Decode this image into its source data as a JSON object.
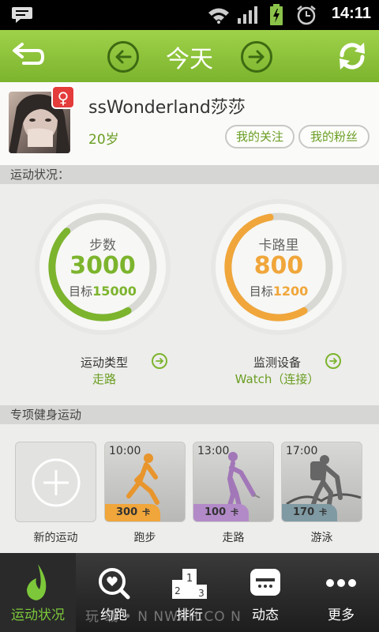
{
  "status_bar": {
    "time": "14:11"
  },
  "title_bar": {
    "title": "今天"
  },
  "profile": {
    "username": "ssWonderland莎莎",
    "age": "20岁",
    "gender_symbol": "♀",
    "buttons": [
      "我的关注",
      "我的粉丝"
    ]
  },
  "sections": {
    "activity_status": "运动状况：",
    "fitness": "专项健身运动"
  },
  "gauges": [
    {
      "label": "步数",
      "value": "3000",
      "target_label": "目标",
      "target": "15000",
      "progress": 0.2,
      "color": "#7cb42d"
    },
    {
      "label": "卡路里",
      "value": "800",
      "target_label": "目标",
      "target": "1200",
      "progress": 0.667,
      "color": "#f0a63a"
    }
  ],
  "info": {
    "sport_type_label": "运动类型",
    "sport_type_value": "走路",
    "device_label": "监测设备",
    "device_value": "Watch（连接）"
  },
  "cards": [
    {
      "label": "新的运动"
    },
    {
      "time": "10:00",
      "cal": "300",
      "unit": "卡",
      "label": "跑步",
      "tag_color": "#f0a63a",
      "figure_color": "#e8952c"
    },
    {
      "time": "13:00",
      "cal": "100",
      "unit": "卡",
      "label": "走路",
      "tag_color": "#b38ac8",
      "figure_color": "#a277b8"
    },
    {
      "time": "17:00",
      "cal": "170",
      "unit": "卡",
      "label": "游泳",
      "tag_color": "#7f9aa3",
      "figure_color": "#666666"
    }
  ],
  "tabs": [
    {
      "label": "运动状况",
      "active": true
    },
    {
      "label": "约跑"
    },
    {
      "label": "排行"
    },
    {
      "label": "动态"
    },
    {
      "label": "更多"
    }
  ],
  "watermark": "玩 载 • N NWXH.CO N",
  "colors": {
    "accent_green": "#7cb42d",
    "text_green": "#6a9e23",
    "orange": "#f0a63a"
  }
}
